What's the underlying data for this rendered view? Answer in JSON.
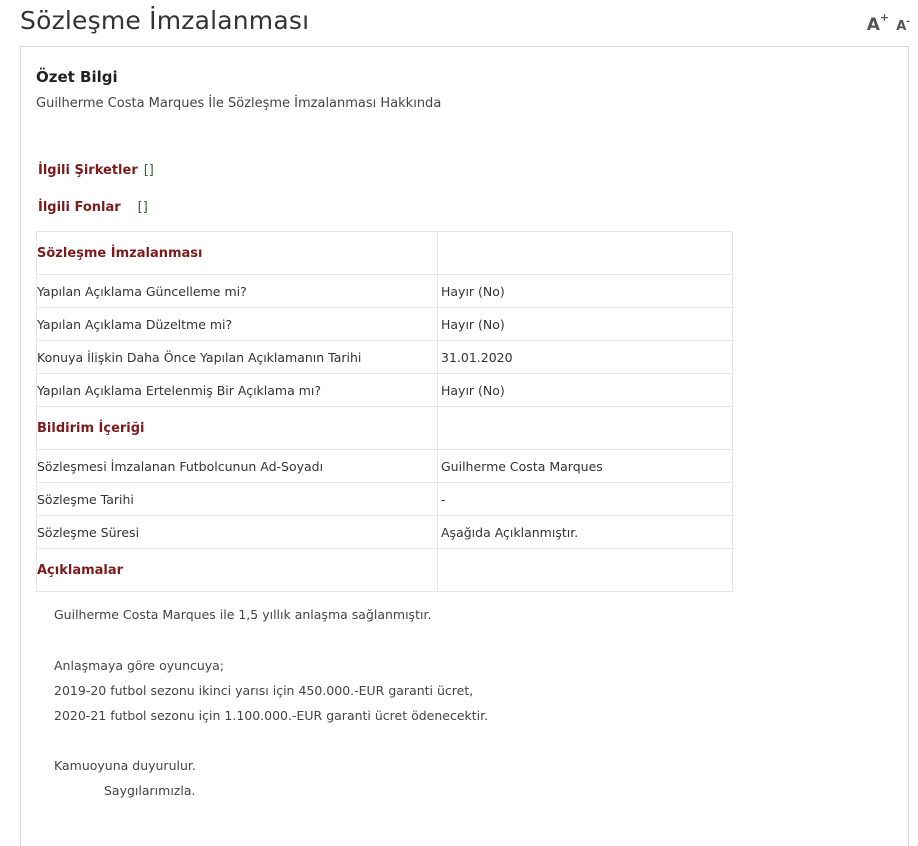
{
  "page": {
    "title": "Sözleşme İmzalanması",
    "font_increase": "A",
    "font_increase_sup": "+",
    "font_decrease": "A",
    "font_decrease_sup": "-"
  },
  "summary": {
    "heading": "Özet Bilgi",
    "text": "Guilherme Costa Marques İle Sözleşme İmzalanması Hakkında"
  },
  "related": {
    "companies_label": "İlgili Şirketler",
    "companies_value": "[]",
    "funds_label": "İlgili Fonlar",
    "funds_value": "[]"
  },
  "table": {
    "section_main": "Sözleşme İmzalanması",
    "rows_main": [
      {
        "label": "Yapılan Açıklama Güncelleme mi?",
        "value": "Hayır (No)"
      },
      {
        "label": "Yapılan Açıklama Düzeltme mi?",
        "value": "Hayır (No)"
      },
      {
        "label": "Konuya İlişkin Daha Önce Yapılan Açıklamanın Tarihi",
        "value": "31.01.2020"
      },
      {
        "label": "Yapılan Açıklama Ertelenmiş Bir Açıklama mı?",
        "value": "Hayır (No)"
      }
    ],
    "section_content": "Bildirim İçeriği",
    "rows_content": [
      {
        "label": "Sözleşmesi İmzalanan Futbolcunun Ad-Soyadı",
        "value": "Guilherme Costa Marques"
      },
      {
        "label": "Sözleşme Tarihi",
        "value": "-"
      },
      {
        "label": "Sözleşme Süresi",
        "value": "Aşağıda Açıklanmıştır."
      }
    ],
    "section_notes": "Açıklamalar"
  },
  "notes": {
    "line1": "Guilherme Costa Marques ile 1,5 yıllık anlaşma sağlanmıştır.",
    "line2": "Anlaşmaya göre oyuncuya;",
    "line3": "2019-20 futbol sezonu ikinci yarısı için 450.000.-EUR garanti ücret,",
    "line4": "2020-21 futbol sezonu için 1.100.000.-EUR garanti ücret ödenecektir.",
    "line5": "Kamuoyuna duyurulur.",
    "line6": "Saygılarımızla."
  }
}
